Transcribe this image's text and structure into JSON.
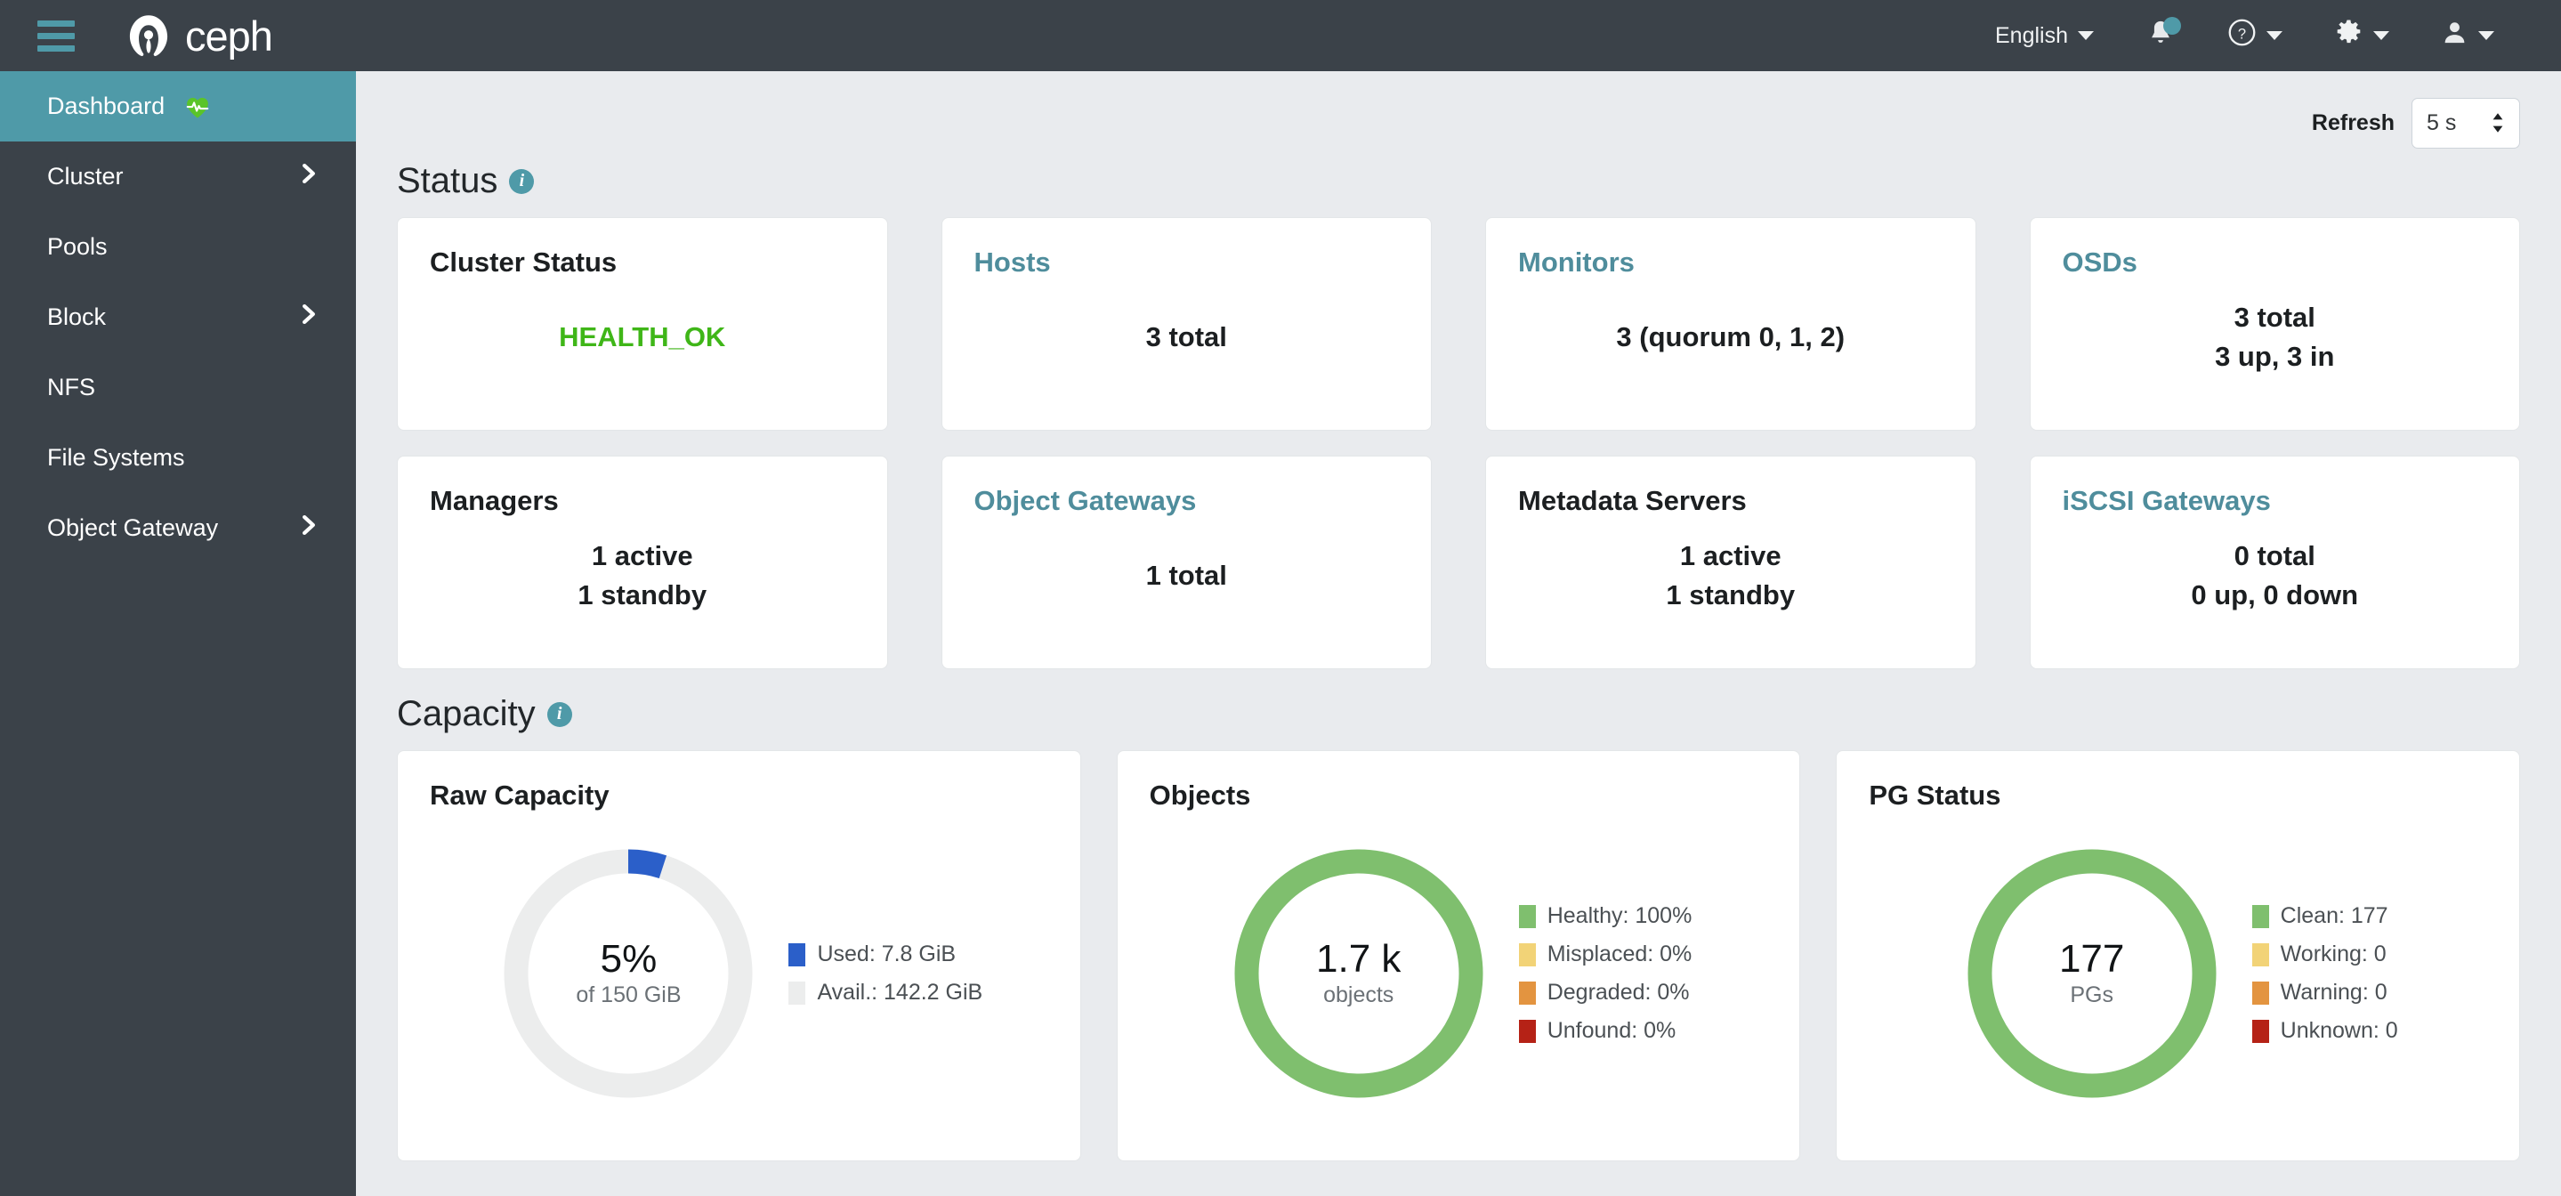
{
  "navbar": {
    "menu_icon": "hamburger-icon",
    "brand": "ceph",
    "language": "English",
    "notifications_icon": "bell-icon",
    "help_icon": "help-circle-icon",
    "settings_icon": "gear-icon",
    "user_icon": "user-icon",
    "accent_color": "#4f9aa8",
    "background_color": "#3b4249"
  },
  "sidebar": {
    "items": [
      {
        "label": "Dashboard",
        "active": true,
        "expandable": false,
        "icon": "heart-pulse-icon"
      },
      {
        "label": "Cluster",
        "active": false,
        "expandable": true
      },
      {
        "label": "Pools",
        "active": false,
        "expandable": false
      },
      {
        "label": "Block",
        "active": false,
        "expandable": true
      },
      {
        "label": "NFS",
        "active": false,
        "expandable": false
      },
      {
        "label": "File Systems",
        "active": false,
        "expandable": false
      },
      {
        "label": "Object Gateway",
        "active": false,
        "expandable": true
      }
    ]
  },
  "toolbar": {
    "refresh_label": "Refresh",
    "refresh_value": "5 s"
  },
  "status": {
    "heading": "Status",
    "info_glyph": "i",
    "cards": [
      {
        "title": "Cluster Status",
        "link": false,
        "lines": [
          "HEALTH_OK"
        ],
        "value_class": "health-ok"
      },
      {
        "title": "Hosts",
        "link": true,
        "lines": [
          "3 total"
        ],
        "value_class": ""
      },
      {
        "title": "Monitors",
        "link": true,
        "lines": [
          "3 (quorum 0, 1, 2)"
        ],
        "value_class": ""
      },
      {
        "title": "OSDs",
        "link": true,
        "lines": [
          "3 total",
          "3 up, 3 in"
        ],
        "value_class": ""
      },
      {
        "title": "Managers",
        "link": false,
        "lines": [
          "1 active",
          "1 standby"
        ],
        "value_class": ""
      },
      {
        "title": "Object Gateways",
        "link": true,
        "lines": [
          "1 total"
        ],
        "value_class": ""
      },
      {
        "title": "Metadata Servers",
        "link": false,
        "lines": [
          "1 active",
          "1 standby"
        ],
        "value_class": ""
      },
      {
        "title": "iSCSI Gateways",
        "link": true,
        "lines": [
          "0 total",
          "0 up, 0 down"
        ],
        "value_class": ""
      }
    ]
  },
  "capacity": {
    "heading": "Capacity",
    "info_glyph": "i",
    "cards": [
      {
        "title": "Raw Capacity",
        "center_value": "5%",
        "center_sub": "of 150 GiB",
        "legend": [
          {
            "label": "Used: 7.8 GiB",
            "color": "#2b5fc9"
          },
          {
            "label": "Avail.: 142.2 GiB",
            "color": "#eceded"
          }
        ]
      },
      {
        "title": "Objects",
        "center_value": "1.7 k",
        "center_sub": "objects",
        "legend": [
          {
            "label": "Healthy: 100%",
            "color": "#7fbf6e"
          },
          {
            "label": "Misplaced: 0%",
            "color": "#f2d377"
          },
          {
            "label": "Degraded: 0%",
            "color": "#e39440"
          },
          {
            "label": "Unfound: 0%",
            "color": "#b52216"
          }
        ]
      },
      {
        "title": "PG Status",
        "center_value": "177",
        "center_sub": "PGs",
        "legend": [
          {
            "label": "Clean: 177",
            "color": "#7fbf6e"
          },
          {
            "label": "Working: 0",
            "color": "#f2d377"
          },
          {
            "label": "Warning: 0",
            "color": "#e39440"
          },
          {
            "label": "Unknown: 0",
            "color": "#b52216"
          }
        ]
      }
    ]
  },
  "chart_data": [
    {
      "type": "pie",
      "title": "Raw Capacity",
      "labels": [
        "Used",
        "Avail."
      ],
      "values": [
        7.8,
        142.2
      ],
      "unit": "GiB",
      "total": 150,
      "used_percent": 5,
      "colors": [
        "#2b5fc9",
        "#eceded"
      ],
      "legend_position": "right",
      "center_label": "5% of 150 GiB"
    },
    {
      "type": "pie",
      "title": "Objects",
      "labels": [
        "Healthy",
        "Misplaced",
        "Degraded",
        "Unfound"
      ],
      "values": [
        100,
        0,
        0,
        0
      ],
      "unit": "%",
      "total": 1700,
      "colors": [
        "#7fbf6e",
        "#f2d377",
        "#e39440",
        "#b52216"
      ],
      "legend_position": "right",
      "center_label": "1.7 k objects"
    },
    {
      "type": "pie",
      "title": "PG Status",
      "labels": [
        "Clean",
        "Working",
        "Warning",
        "Unknown"
      ],
      "values": [
        177,
        0,
        0,
        0
      ],
      "unit": "PGs",
      "total": 177,
      "colors": [
        "#7fbf6e",
        "#f2d377",
        "#e39440",
        "#b52216"
      ],
      "legend_position": "right",
      "center_label": "177 PGs"
    }
  ]
}
